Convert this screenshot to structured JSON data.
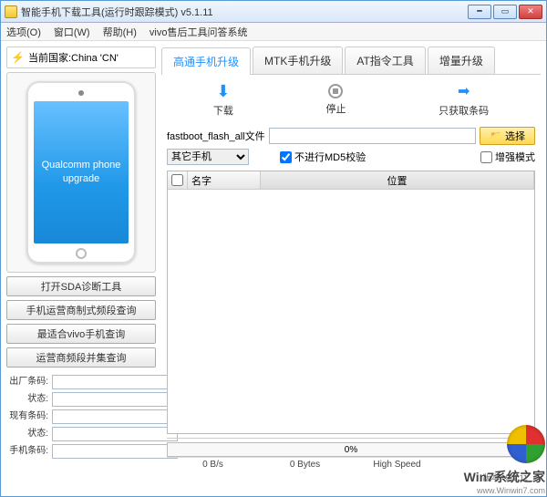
{
  "window": {
    "title": "智能手机下载工具(运行时跟踪模式)  v5.1.11"
  },
  "menu": {
    "options": "选项(O)",
    "window": "窗口(W)",
    "help": "帮助(H)",
    "qa": "vivo售后工具问答系统"
  },
  "sidebar": {
    "country_label": "当前国家:China 'CN'",
    "phone_text": "Qualcomm phone upgrade",
    "btn_sda": "打开SDA诊断工具",
    "btn_carrier": "手机运营商制式频段查询",
    "btn_vivo": "最适合vivo手机查询",
    "btn_freq": "运营商频段并集查询",
    "info": {
      "fac_barcode": "出厂条码:",
      "status1": "状态:",
      "cur_barcode": "现有条码:",
      "status2": "状态:",
      "phone_barcode": "手机条码:"
    }
  },
  "tabs": [
    "高通手机升级",
    "MTK手机升级",
    "AT指令工具",
    "增量升级"
  ],
  "tools": {
    "download": "下载",
    "stop": "停止",
    "barcode": "只获取条码"
  },
  "form": {
    "file_label": "fastboot_flash_all文件",
    "file_value": "",
    "browse": "选择",
    "select_value": "其它手机",
    "md5": "不进行MD5校验",
    "enhance": "增强模式"
  },
  "table": {
    "col_name": "名字",
    "col_loc": "位置"
  },
  "status": {
    "progress": "0%",
    "speed": "0 B/s",
    "bytes": "0 Bytes",
    "mode": "High Speed",
    "extra": "",
    "version": "版本 v5.1.11"
  },
  "watermark": {
    "txt1": "Win7系统之家",
    "txt2": "www.Winwin7.com"
  }
}
